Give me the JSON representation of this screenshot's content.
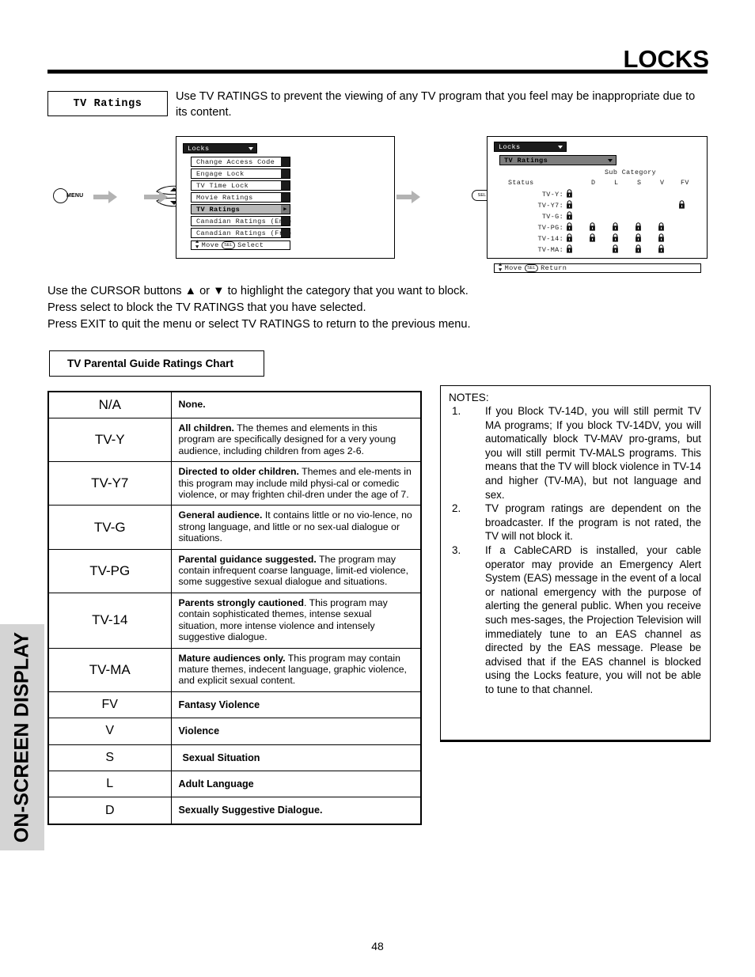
{
  "page": {
    "title": "LOCKS",
    "number": "48",
    "side_tab_label": "ON-SCREEN DISPLAY"
  },
  "intro": {
    "box_label": "TV Ratings",
    "text": "Use TV RATINGS to prevent the viewing of any TV program that you feel may be inappropriate due to its content."
  },
  "flow": {
    "menu_button_label": "MENU",
    "select_button_label": "SEL",
    "osd_left": {
      "header": "Locks",
      "items": [
        "Change Access Code",
        "Engage Lock",
        "TV Time Lock",
        "Movie Ratings",
        "TV Ratings",
        "Canadian Ratings (Eng)",
        "Canadian Ratings (Frn)"
      ],
      "selected_index": 4,
      "footer_move": "Move",
      "footer_key": "SEL",
      "footer_action": "Select"
    },
    "osd_right": {
      "header": "Locks",
      "subheader": "TV Ratings",
      "sub_category_label": "Sub Category",
      "status_label": "Status",
      "columns": [
        "D",
        "L",
        "S",
        "V",
        "FV"
      ],
      "rows": [
        {
          "label": "TV-Y:",
          "status_locked": true,
          "locks": [
            false,
            false,
            false,
            false,
            false
          ]
        },
        {
          "label": "TV-Y7:",
          "status_locked": true,
          "locks": [
            false,
            false,
            false,
            false,
            true
          ]
        },
        {
          "label": "TV-G:",
          "status_locked": true,
          "locks": [
            false,
            false,
            false,
            false,
            false
          ]
        },
        {
          "label": "TV-PG:",
          "status_locked": true,
          "locks": [
            true,
            true,
            true,
            true,
            false
          ]
        },
        {
          "label": "TV-14:",
          "status_locked": true,
          "locks": [
            true,
            true,
            true,
            true,
            false
          ]
        },
        {
          "label": "TV-MA:",
          "status_locked": true,
          "locks": [
            false,
            true,
            true,
            true,
            false
          ]
        }
      ],
      "footer_move": "Move",
      "footer_key": "SEL",
      "footer_action": "Return"
    }
  },
  "instructions": [
    "Use the CURSOR buttons ▲ or ▼ to highlight the category that you want to block.",
    "Press select to block the TV RATINGS that you have selected.",
    "Press EXIT to quit the menu or select TV RATINGS to return to the previous menu."
  ],
  "chart": {
    "title": "TV Parental Guide Ratings Chart",
    "rows": [
      {
        "code": "N/A",
        "bold": "None.",
        "rest": "",
        "simple": false
      },
      {
        "code": "TV-Y",
        "bold": "All children.",
        "rest": " The themes and elements in this program are specifically designed for a very young audience, including children from ages 2-6.",
        "simple": false
      },
      {
        "code": "TV-Y7",
        "bold": "Directed to older children.",
        "rest": " Themes and ele-ments in this program may include mild physi-cal or comedic violence, or may frighten chil-dren under the age of 7.",
        "simple": false
      },
      {
        "code": "TV-G",
        "bold": "General audience.",
        "rest": " It contains little or no vio-lence, no strong language, and little or no sex-ual dialogue or situations.",
        "simple": false
      },
      {
        "code": "TV-PG",
        "bold": "Parental guidance suggested.",
        "rest": " The program may contain infrequent coarse language, limit-ed violence, some suggestive sexual dialogue and situations.",
        "simple": false
      },
      {
        "code": "TV-14",
        "bold": "Parents strongly cautioned",
        "rest": ". This program may contain sophisticated themes, intense sexual situation, more intense violence and intensely suggestive dialogue.",
        "simple": false
      },
      {
        "code": "TV-MA",
        "bold": "Mature audiences only.",
        "rest": " This program may contain mature themes, indecent language, graphic violence, and explicit sexual content.",
        "simple": false
      },
      {
        "code": "FV",
        "bold": "Fantasy Violence",
        "rest": "",
        "simple": true,
        "indent": false
      },
      {
        "code": "V",
        "bold": "Violence",
        "rest": "",
        "simple": true,
        "indent": false
      },
      {
        "code": "S",
        "bold": "Sexual Situation",
        "rest": "",
        "simple": true,
        "indent": true
      },
      {
        "code": "L",
        "bold": "Adult Language",
        "rest": "",
        "simple": true,
        "indent": false
      },
      {
        "code": "D",
        "bold": "Sexually Suggestive Dialogue.",
        "rest": "",
        "simple": true,
        "indent": false
      }
    ]
  },
  "notes": {
    "heading": "NOTES:",
    "items": [
      {
        "num": "1.",
        "text": "If you Block TV-14D, you will still permit TV MA programs; If you block TV-14DV, you will automatically block TV-MAV pro-grams, but you will still permit TV-MALS programs. This means that the TV will block violence in TV-14 and higher (TV-MA), but not language and sex."
      },
      {
        "num": "2.",
        "text": "TV program ratings are dependent on the broadcaster.  If the program is not rated, the TV will not block it."
      },
      {
        "num": "3.",
        "text": "If a CableCARD is installed, your cable operator may provide an Emergency Alert System (EAS) message in the event of a local or national emergency with the purpose of alerting the general public.  When you receive such mes-sages, the Projection Television will immediately tune to an EAS channel as directed by the EAS message.  Please be advised that if the EAS channel is blocked using the Locks feature, you will not be able to tune to that channel."
      }
    ]
  },
  "colors": {
    "side_tab_bg": "#d4d4d4",
    "osd_header_bg": "#1b1b1b",
    "osd_selected_bg": "#b9b9b9",
    "arrow_gray": "#b3b3b3"
  }
}
